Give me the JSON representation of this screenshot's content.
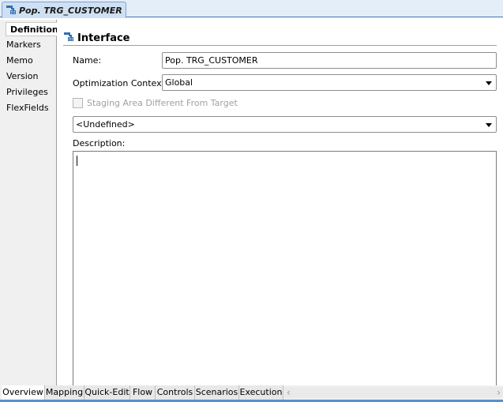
{
  "editor_tab": {
    "title": "Pop. TRG_CUSTOMER",
    "icon": "interface-icon"
  },
  "sidebar": {
    "items": [
      {
        "label": "Definition",
        "active": true
      },
      {
        "label": "Markers",
        "active": false
      },
      {
        "label": "Memo",
        "active": false
      },
      {
        "label": "Version",
        "active": false
      },
      {
        "label": "Privileges",
        "active": false
      },
      {
        "label": "FlexFields",
        "active": false
      }
    ]
  },
  "section": {
    "title": "Interface",
    "icon": "interface-icon"
  },
  "form": {
    "name_label": "Name:",
    "name_value": "Pop. TRG_CUSTOMER",
    "context_label": "Optimization Context:",
    "context_value": "Global",
    "staging_label": "Staging Area Different From Target",
    "staging_checked": false,
    "staging_enabled": false,
    "staging_select_value": "<Undefined>",
    "description_label": "Description:",
    "description_value": ""
  },
  "bottom_tabs": [
    {
      "label": "Overview",
      "active": true
    },
    {
      "label": "Mapping",
      "active": false
    },
    {
      "label": "Quick-Edit",
      "active": false
    },
    {
      "label": "Flow",
      "active": false
    },
    {
      "label": "Controls",
      "active": false
    },
    {
      "label": "Scenarios",
      "active": false
    },
    {
      "label": "Execution",
      "active": false
    }
  ],
  "scrollbar": {
    "left_arrow": "‹",
    "right_arrow": "›"
  }
}
